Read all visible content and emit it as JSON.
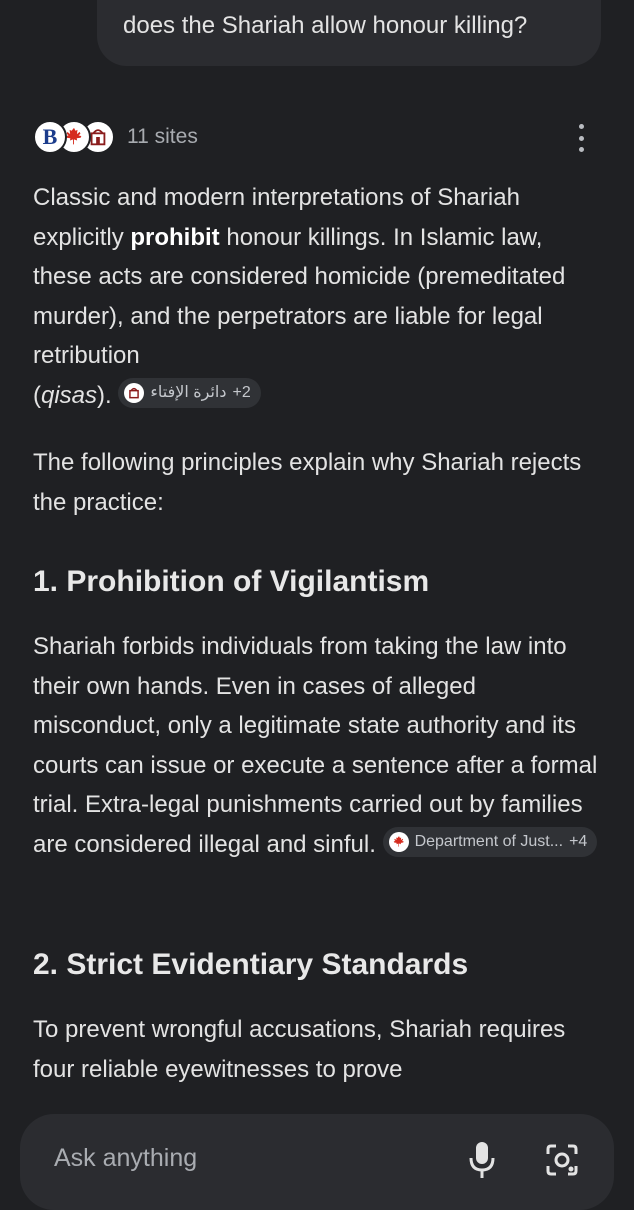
{
  "user_message": "does the Shariah allow honour killing?",
  "sources": {
    "count_label": "11 sites",
    "icons": [
      "b-logo-icon",
      "maple-leaf-icon",
      "ifta-logo-icon"
    ]
  },
  "answer": {
    "intro": {
      "t1": "Classic and modern interpretations of Shariah explicitly ",
      "bold": "prohibit",
      "t2": " honour killings. In Islamic law, these acts are considered homicide (premeditated murder), and the perpetrators are liable for legal retribution",
      "t3": "(",
      "italic": "qisas",
      "t4": ").",
      "chip": {
        "text": "دائرة الإفتاء",
        "extra": "+2",
        "icon": "ifta-logo-icon"
      }
    },
    "lead": "The following principles explain why Shariah rejects the practice:",
    "section1": {
      "heading": "1. Prohibition of Vigilantism",
      "body": "Shariah forbids individuals from taking the law into their own hands. Even in cases of alleged misconduct, only a legitimate state authority and its courts can issue or execute a sentence after a formal trial. Extra-legal punishments carried out by families are considered illegal and sinful.",
      "chip": {
        "text": "Department of Just...",
        "extra": "+4",
        "icon": "maple-leaf-icon"
      }
    },
    "section2": {
      "heading": "2. Strict Evidentiary Standards",
      "body": "To prevent wrongful accusations, Shariah requires four reliable eyewitnesses to prove"
    }
  },
  "input": {
    "placeholder": "Ask anything",
    "icons": [
      "microphone-icon",
      "camera-lens-icon"
    ]
  },
  "colors": {
    "background": "#1f2023",
    "surface": "#2b2c30",
    "text": "#e3e3e3",
    "muted": "#a8abb0",
    "chip": "#303236"
  }
}
